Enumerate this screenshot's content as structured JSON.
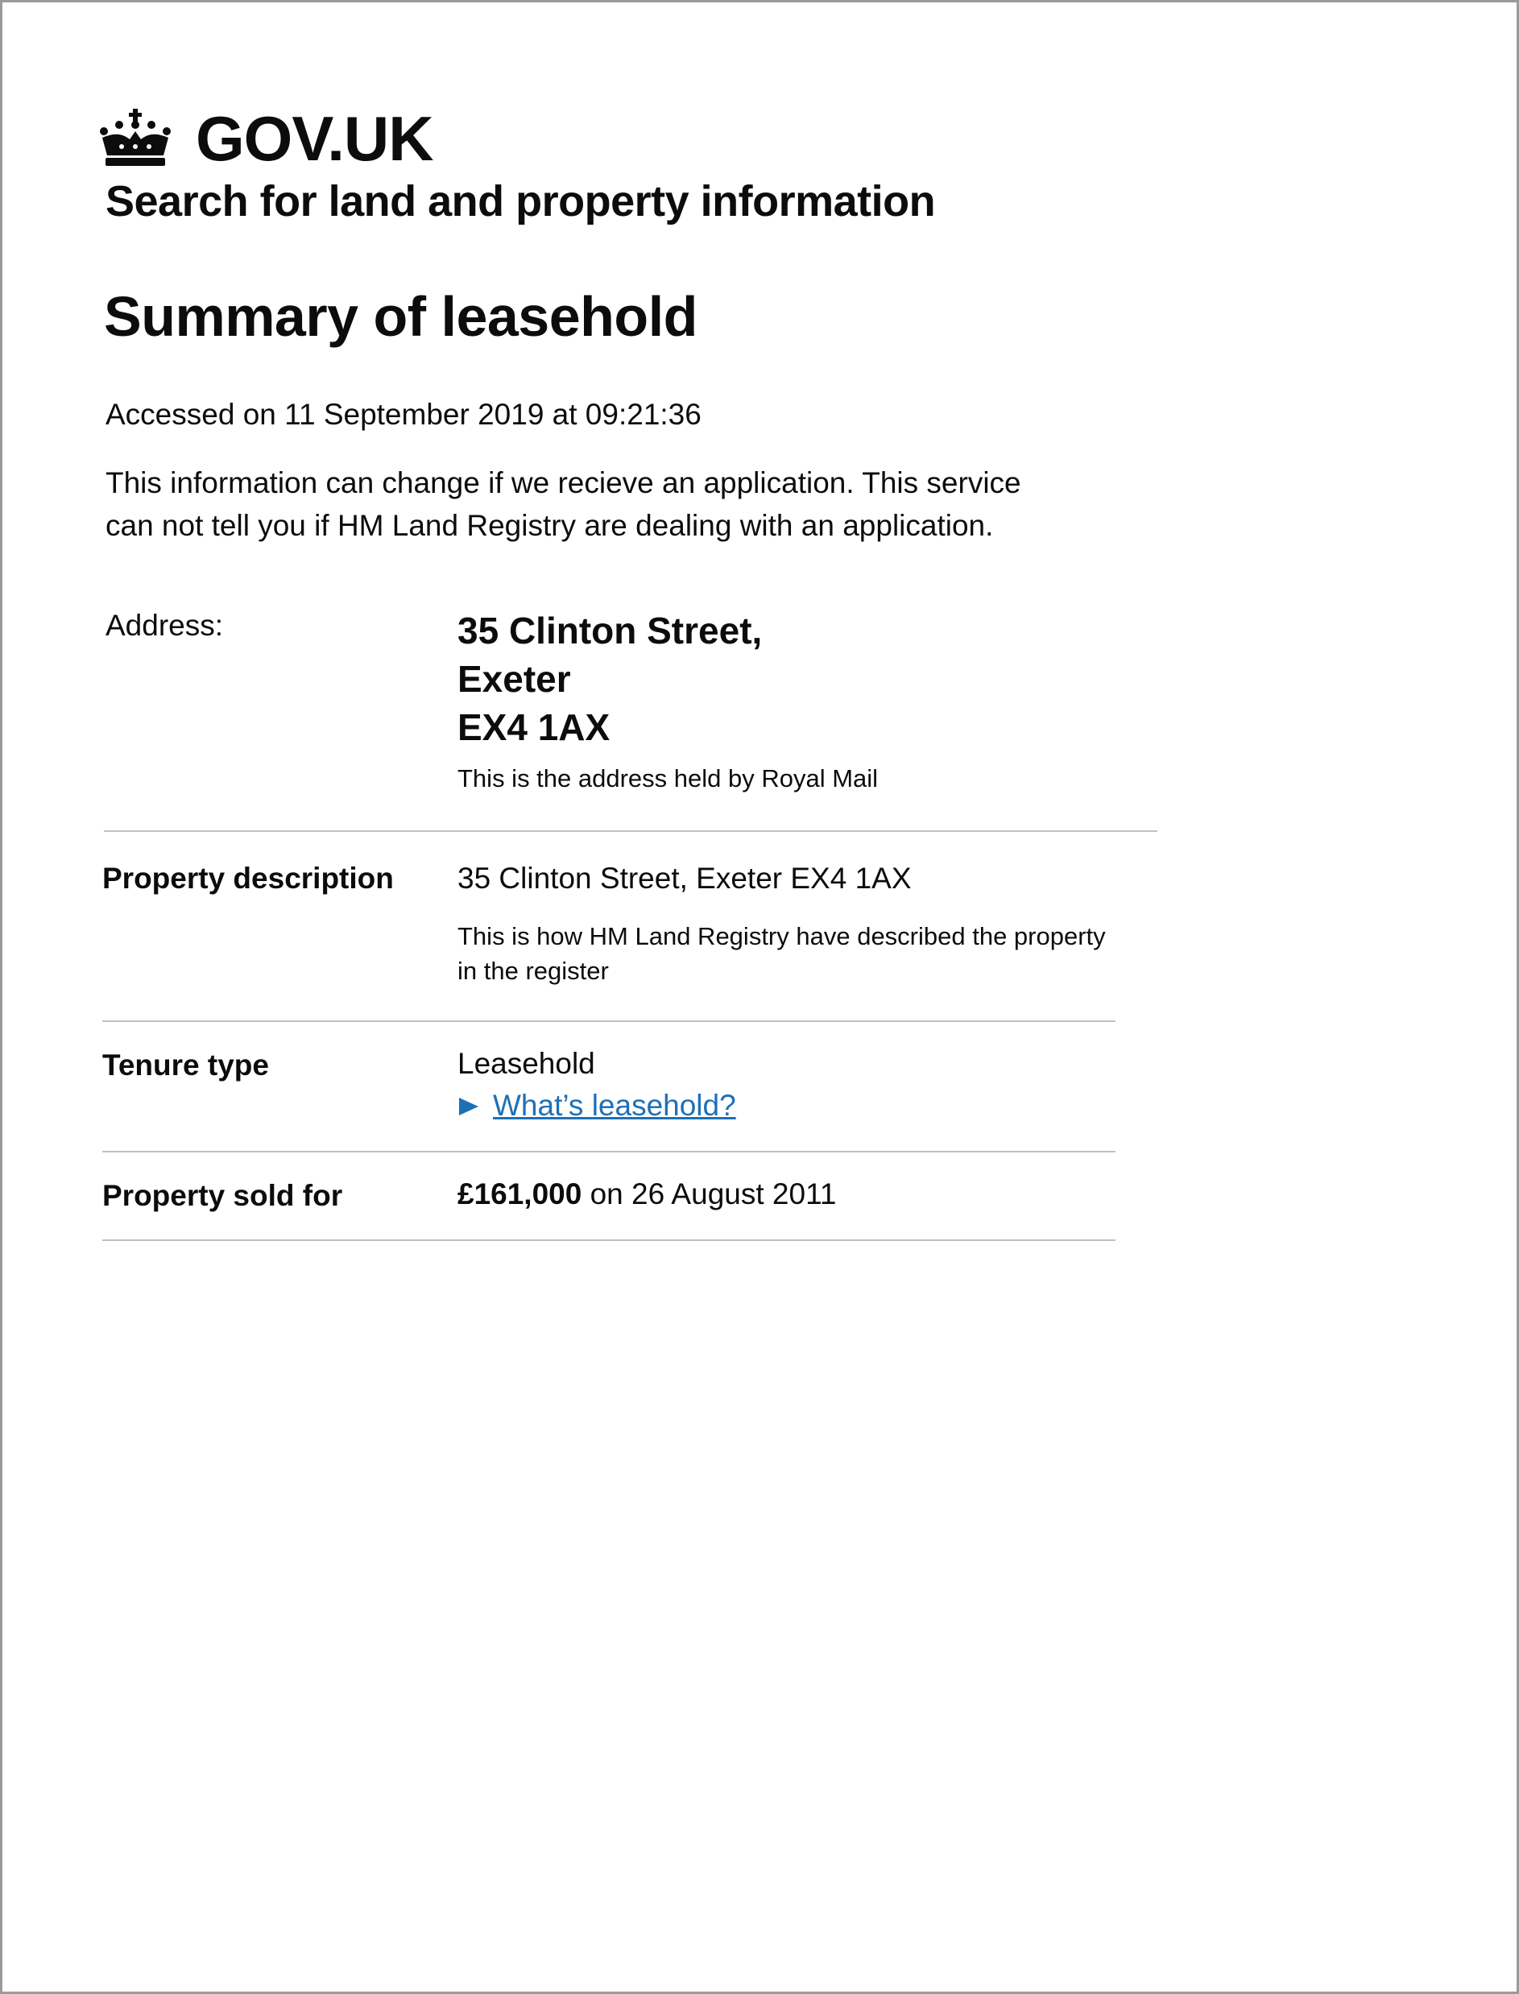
{
  "header": {
    "brand": "GOV.UK",
    "crown_icon": "crown-icon",
    "service_name": "Search for land and property information"
  },
  "page": {
    "title": "Summary of leasehold",
    "accessed": "Accessed on 11 September 2019 at 09:21:36",
    "notice": "This information can change if we recieve an application. This service can not tell you if HM Land Registry are dealing with an application."
  },
  "summary": {
    "address": {
      "label": "Address:",
      "lines": [
        "35 Clinton Street,",
        "Exeter",
        "EX4 1AX"
      ],
      "hint": "This is the address held by Royal Mail"
    },
    "property_description": {
      "label": "Property description",
      "value": "35 Clinton Street, Exeter EX4 1AX",
      "hint": "This is how HM Land Registry have described the property in the register"
    },
    "tenure_type": {
      "label": "Tenure type",
      "value": "Leasehold",
      "details_icon": "triangle-right-icon",
      "details_link": "What’s leasehold?"
    },
    "sold_for": {
      "label": "Property sold for",
      "price": "£161,000",
      "date_text": " on 26 August 2011"
    }
  },
  "colors": {
    "text": "#0b0c0c",
    "link": "#1d70b8",
    "divider": "#bfc1c3",
    "page_border": "#9a9a9a"
  }
}
